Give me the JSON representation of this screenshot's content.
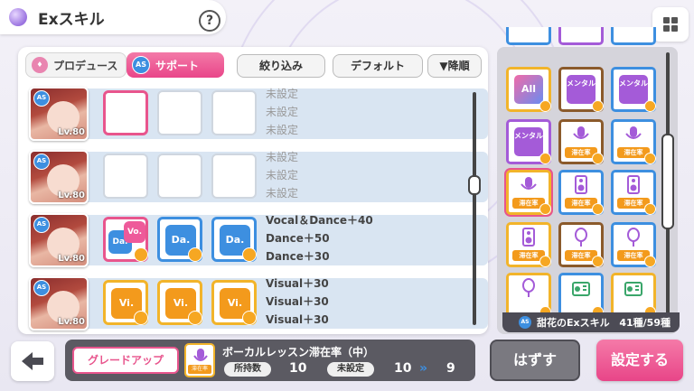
{
  "header": {
    "title": "Exスキル",
    "help": "?"
  },
  "tabs": {
    "produce": "プロデュース",
    "support": "サポート",
    "badge": "AS"
  },
  "filters": {
    "narrow": "絞り込み",
    "default": "デフォルト",
    "order": "▼降順"
  },
  "rows": [
    {
      "level": "Lv.80",
      "skills": [
        "未設定",
        "未設定",
        "未設定"
      ],
      "cards": []
    },
    {
      "level": "Lv.80",
      "skills": [
        "未設定",
        "未設定",
        "未設定"
      ],
      "cards": []
    },
    {
      "level": "Lv.80",
      "skills": [
        "Vocal＆Dance＋40",
        "Dance＋50",
        "Dance＋30"
      ],
      "cards": [
        "Vo.|Da.",
        "Da.",
        "Da."
      ]
    },
    {
      "level": "Lv.80",
      "skills": [
        "Visual＋30",
        "Visual＋30",
        "Visual＋30"
      ],
      "cards": [
        "Vi.",
        "Vi.",
        "Vi."
      ]
    }
  ],
  "grid": {
    "footer_label": "甜花のExスキル",
    "footer_count": "41種/59種",
    "cells": [
      {
        "icon": "",
        "tag": ""
      },
      {
        "icon": "",
        "tag": ""
      },
      {
        "icon": "",
        "tag": ""
      },
      {
        "icon": "All",
        "tag": ""
      },
      {
        "icon": "メンタル",
        "tag": ""
      },
      {
        "icon": "メンタル",
        "tag": ""
      },
      {
        "icon": "メンタル",
        "tag": ""
      },
      {
        "icon": "mic-icon",
        "tag": "滞在率"
      },
      {
        "icon": "mic-icon",
        "tag": "滞在率"
      },
      {
        "icon": "mic-icon",
        "tag": "滞在率"
      },
      {
        "icon": "speaker-icon",
        "tag": "滞在率"
      },
      {
        "icon": "speaker-icon",
        "tag": "滞在率"
      },
      {
        "icon": "speaker-icon",
        "tag": "滞在率"
      },
      {
        "icon": "mirror-icon",
        "tag": "滞在率"
      },
      {
        "icon": "mirror-icon",
        "tag": "滞在率"
      },
      {
        "icon": "mirror-icon",
        "tag": ""
      },
      {
        "icon": "radio-icon",
        "tag": ""
      },
      {
        "icon": "radio-icon",
        "tag": ""
      }
    ]
  },
  "bottom": {
    "grade_up": "グレードアップ",
    "mini_tag": "滞在率",
    "skill_name": "ボーカルレッスン滞在率（中）",
    "owned_label": "所持数",
    "owned_value": "10",
    "unset_label": "未設定",
    "unset_from": "10",
    "arrow": "»",
    "unset_to": "9",
    "remove": "はずす",
    "set": "設定する"
  },
  "colors": {
    "pink": "#e8558d",
    "blue": "#3d8fe0",
    "yellow": "#f2b42a",
    "purple": "#8e4bd6",
    "orange": "#f39a1c"
  }
}
